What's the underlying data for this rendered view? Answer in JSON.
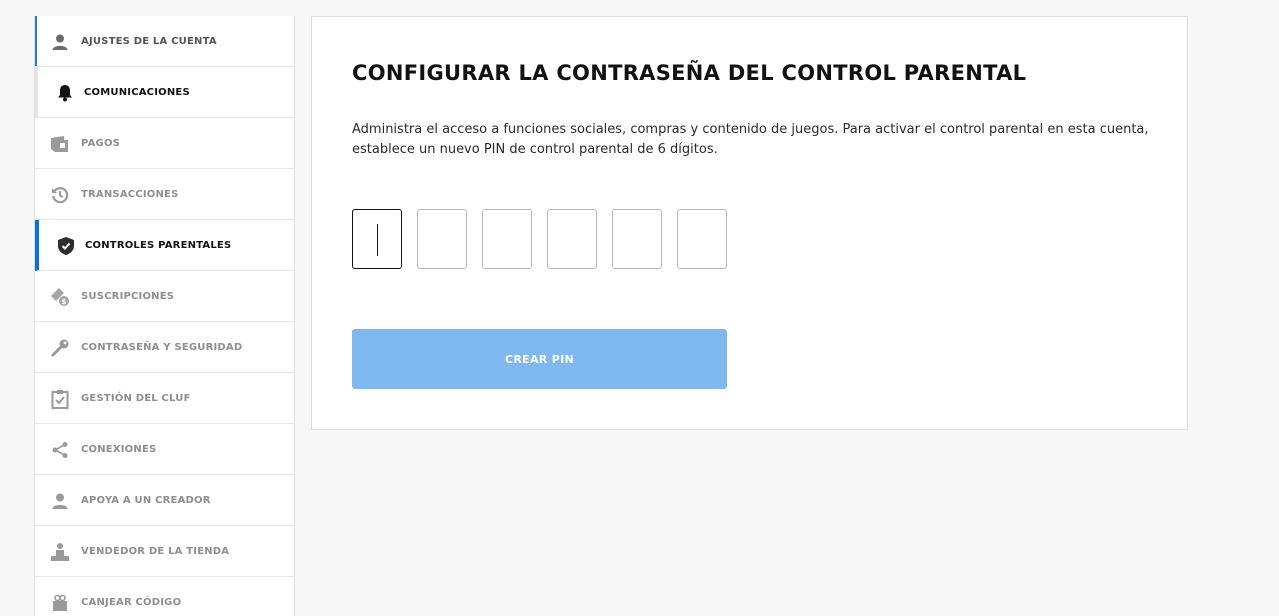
{
  "sidebar": {
    "items": [
      {
        "label": "AJUSTES DE LA CUENTA",
        "icon": "user-icon"
      },
      {
        "label": "COMUNICACIONES",
        "icon": "bell-icon"
      },
      {
        "label": "PAGOS",
        "icon": "wallet-icon"
      },
      {
        "label": "TRANSACCIONES",
        "icon": "history-icon"
      },
      {
        "label": "CONTROLES PARENTALES",
        "icon": "shield-check-icon"
      },
      {
        "label": "SUSCRIPCIONES",
        "icon": "subscription-icon"
      },
      {
        "label": "CONTRASEÑA Y SEGURIDAD",
        "icon": "key-icon"
      },
      {
        "label": "GESTIÓN DEL CLUF",
        "icon": "clipboard-check-icon"
      },
      {
        "label": "CONEXIONES",
        "icon": "share-icon"
      },
      {
        "label": "APOYA A UN CREADOR",
        "icon": "user-icon"
      },
      {
        "label": "VENDEDOR DE LA TIENDA",
        "icon": "seller-icon"
      },
      {
        "label": "CANJEAR CÓDIGO",
        "icon": "gift-icon"
      }
    ]
  },
  "main": {
    "title": "CONFIGURAR LA CONTRASEÑA DEL CONTROL PARENTAL",
    "description": "Administra el acceso a funciones sociales, compras y contenido de juegos. Para activar el control parental en esta cuenta, establece un nuevo PIN de control parental de 6 dígitos.",
    "pin_digits": [
      "",
      "",
      "",
      "",
      "",
      ""
    ],
    "create_button": "CREAR PIN"
  },
  "colors": {
    "accent": "#0a6fdf",
    "button_disabled": "#7eb8ef"
  }
}
